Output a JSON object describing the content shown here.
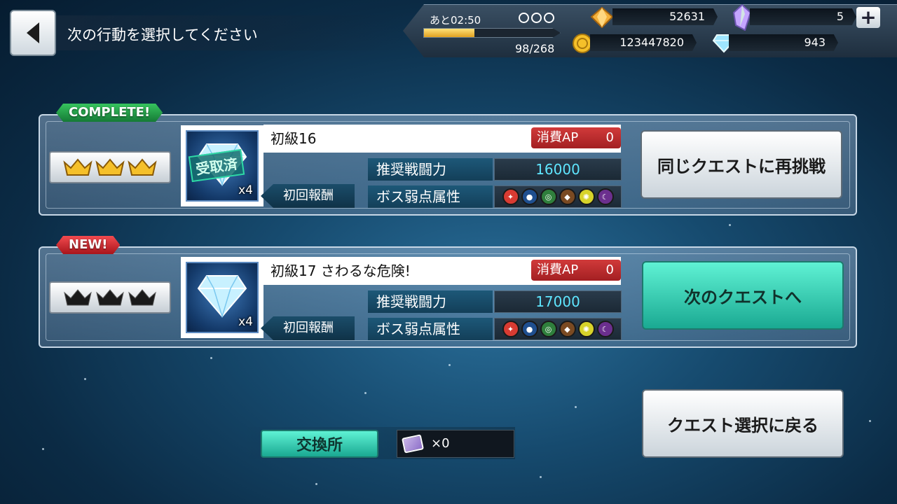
{
  "header": {
    "title": "次の行動を選択してください"
  },
  "status": {
    "ap_timer": "あと02:50",
    "ap_count": "98/268",
    "ap_fill": 0.37,
    "gems_orange": "52631",
    "crystals": "5",
    "gold": "123447820",
    "diamonds": "943"
  },
  "quests": [
    {
      "ribbon": "COMPLETE!",
      "ribbon_color": "#1e9e48",
      "name": "初級16",
      "ap_label": "消費AP",
      "ap_value": "0",
      "power_label": "推奨戦闘力",
      "power_value": "16000",
      "weak_label": "ボス弱点属性",
      "reward_label": "初回報酬",
      "reward_qty": "x4",
      "stamp": "受取済",
      "crowns": "gold",
      "button": "同じクエストに再挑戦"
    },
    {
      "ribbon": "NEW!",
      "ribbon_color": "#d8262b",
      "name": "初級17 さわるな危険!",
      "ap_label": "消費AP",
      "ap_value": "0",
      "power_label": "推奨戦闘力",
      "power_value": "17000",
      "weak_label": "ボス弱点属性",
      "reward_label": "初回報酬",
      "reward_qty": "x4",
      "crowns": "black",
      "button": "次のクエストへ"
    }
  ],
  "elements": [
    {
      "name": "fire-icon",
      "color": "#d83b32",
      "glyph": "✦"
    },
    {
      "name": "water-icon",
      "color": "#1f4f8f",
      "glyph": "●"
    },
    {
      "name": "wind-icon",
      "color": "#2f7f3c",
      "glyph": "◎"
    },
    {
      "name": "earth-icon",
      "color": "#7a4a22",
      "glyph": "◆"
    },
    {
      "name": "light-icon",
      "color": "#d7d32a",
      "glyph": "✺"
    },
    {
      "name": "dark-icon",
      "color": "#6b2f8e",
      "glyph": "☾"
    }
  ],
  "bottom": {
    "back_to_select": "クエスト選択に戻る",
    "exchange": "交換所",
    "ticket_count": "×0"
  }
}
